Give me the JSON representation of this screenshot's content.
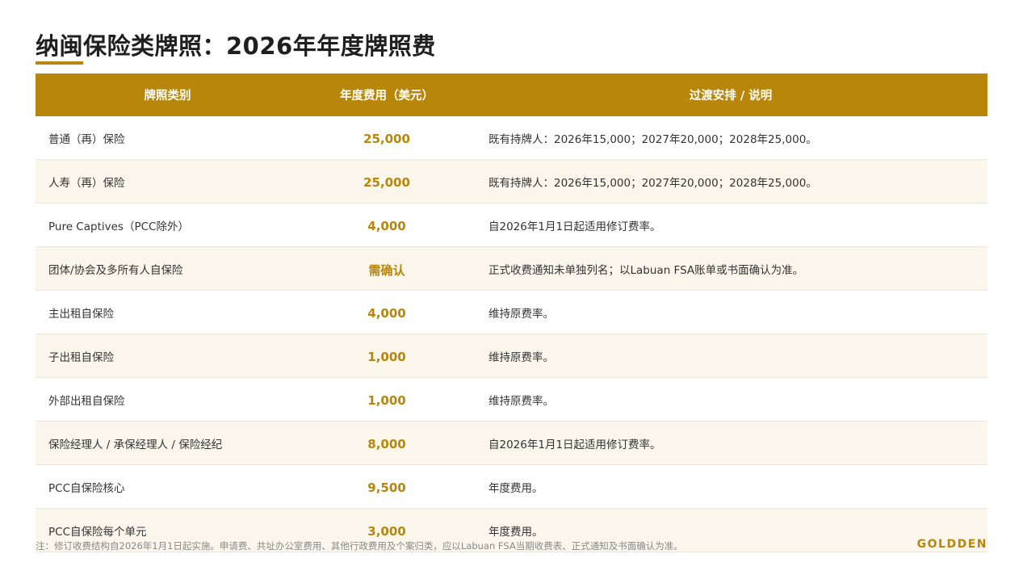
{
  "title": "纳闽保险类牌照：2026年年度牌照费",
  "table": {
    "headers": [
      "牌照类别",
      "年度费用（美元）",
      "过渡安排 / 说明"
    ],
    "rows": [
      {
        "category": "普通（再）保险",
        "fee": "25,000",
        "note": "既有持牌人：2026年15,000；2027年20,000；2028年25,000。"
      },
      {
        "category": "人寿（再）保险",
        "fee": "25,000",
        "note": "既有持牌人：2026年15,000；2027年20,000；2028年25,000。"
      },
      {
        "category": "Pure Captives（PCC除外）",
        "fee": "4,000",
        "note": "自2026年1月1日起适用修订费率。"
      },
      {
        "category": "团体/协会及多所有人自保险",
        "fee": "需确认",
        "note": "正式收费通知未单独列名；以Labuan FSA账单或书面确认为准。"
      },
      {
        "category": "主出租自保险",
        "fee": "4,000",
        "note": "维持原费率。"
      },
      {
        "category": "子出租自保险",
        "fee": "1,000",
        "note": "维持原费率。"
      },
      {
        "category": "外部出租自保险",
        "fee": "1,000",
        "note": "维持原费率。"
      },
      {
        "category": "保险经理人 / 承保经理人 / 保险经纪",
        "fee": "8,000",
        "note": "自2026年1月1日起适用修订费率。"
      },
      {
        "category": "PCC自保险核心",
        "fee": "9,500",
        "note": "年度费用。"
      },
      {
        "category": "PCC自保险每个单元",
        "fee": "3,000",
        "note": "年度费用。"
      }
    ]
  },
  "footnote": "注：修订收费结构自2026年1月1日起实施。申请费、共址办公室费用、其他行政费用及个案归类，应以Labuan FSA当期收费表、正式通知及书面确认为准。",
  "brand": "GOLDDEN",
  "colors": {
    "accent": "#b8860b",
    "row_alt": "#faf6ec"
  }
}
